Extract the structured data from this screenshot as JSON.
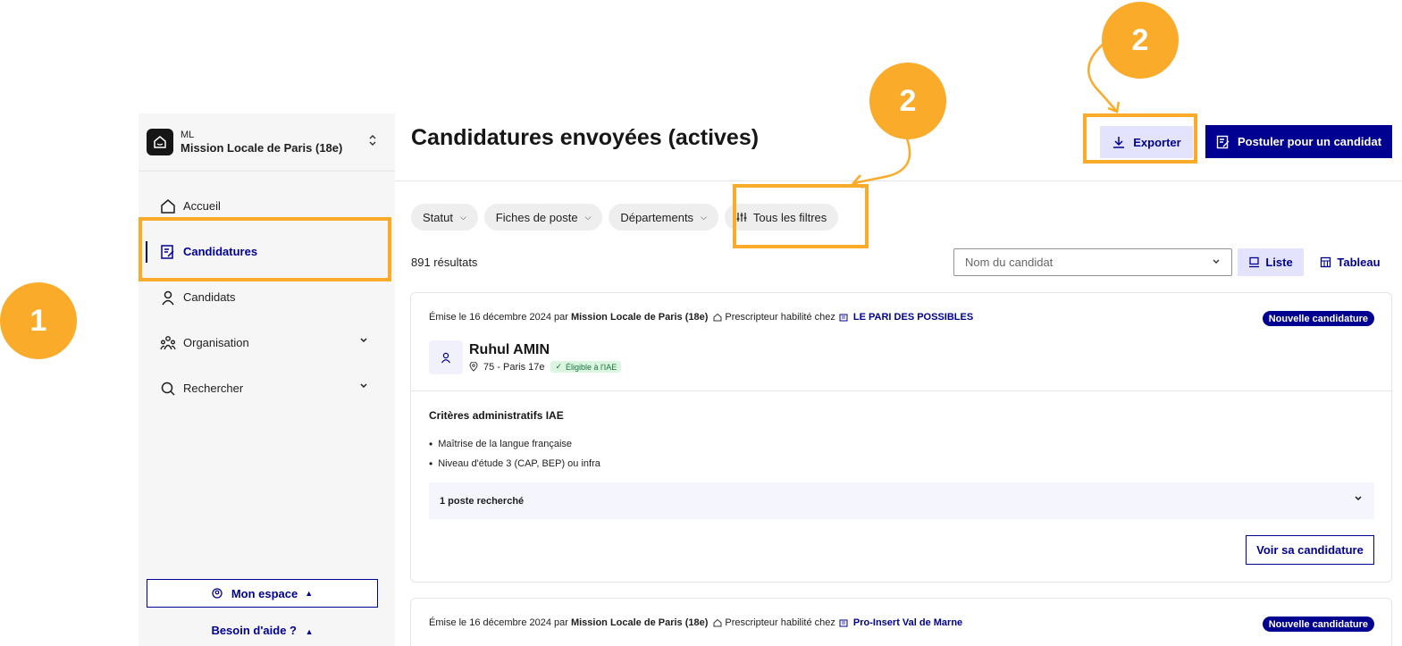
{
  "sidebar": {
    "org_code": "ML",
    "org_name": "Mission Locale de Paris (18e)",
    "items": [
      {
        "label": "Accueil"
      },
      {
        "label": "Candidatures"
      },
      {
        "label": "Candidats"
      },
      {
        "label": "Organisation"
      },
      {
        "label": "Rechercher"
      }
    ],
    "mon_espace": "Mon espace",
    "besoin": "Besoin d'aide ?"
  },
  "header": {
    "title": "Candidatures envoyées (actives)",
    "export": "Exporter",
    "postuler": "Postuler pour un candidat"
  },
  "filters": {
    "statut": "Statut",
    "fiches": "Fiches de poste",
    "departements": "Départements",
    "tous": "Tous les filtres"
  },
  "results": {
    "count": "891 résultats",
    "search_placeholder": "Nom du candidat",
    "liste": "Liste",
    "tableau": "Tableau"
  },
  "cards": [
    {
      "emitted_prefix": "Émise le 16 décembre 2024 par",
      "emitter": "Mission Locale de Paris (18e)",
      "prescripteur": "Prescripteur habilité chez",
      "company": "LE PARI DES POSSIBLES",
      "badge": "Nouvelle candidature",
      "name": "Ruhul AMIN",
      "location": "75 - Paris 17e",
      "eligibility": "Éligible à l'IAE",
      "criteria_title": "Critères administratifs IAE",
      "criteria": [
        "Maîtrise de la langue française",
        "Niveau d'étude 3 (CAP, BEP) ou infra"
      ],
      "postes": "1 poste recherché",
      "voir": "Voir sa candidature"
    },
    {
      "emitted_prefix": "Émise le 16 décembre 2024 par",
      "emitter": "Mission Locale de Paris (18e)",
      "prescripteur": "Prescripteur habilité chez",
      "company": "Pro-Insert Val de Marne",
      "badge": "Nouvelle candidature"
    }
  ],
  "annotations": {
    "step1": "1",
    "step2a": "2",
    "step2b": "2",
    "color": "#fbab2a"
  },
  "colors": {
    "primary": "#000091",
    "accent": "#fbab2a"
  }
}
